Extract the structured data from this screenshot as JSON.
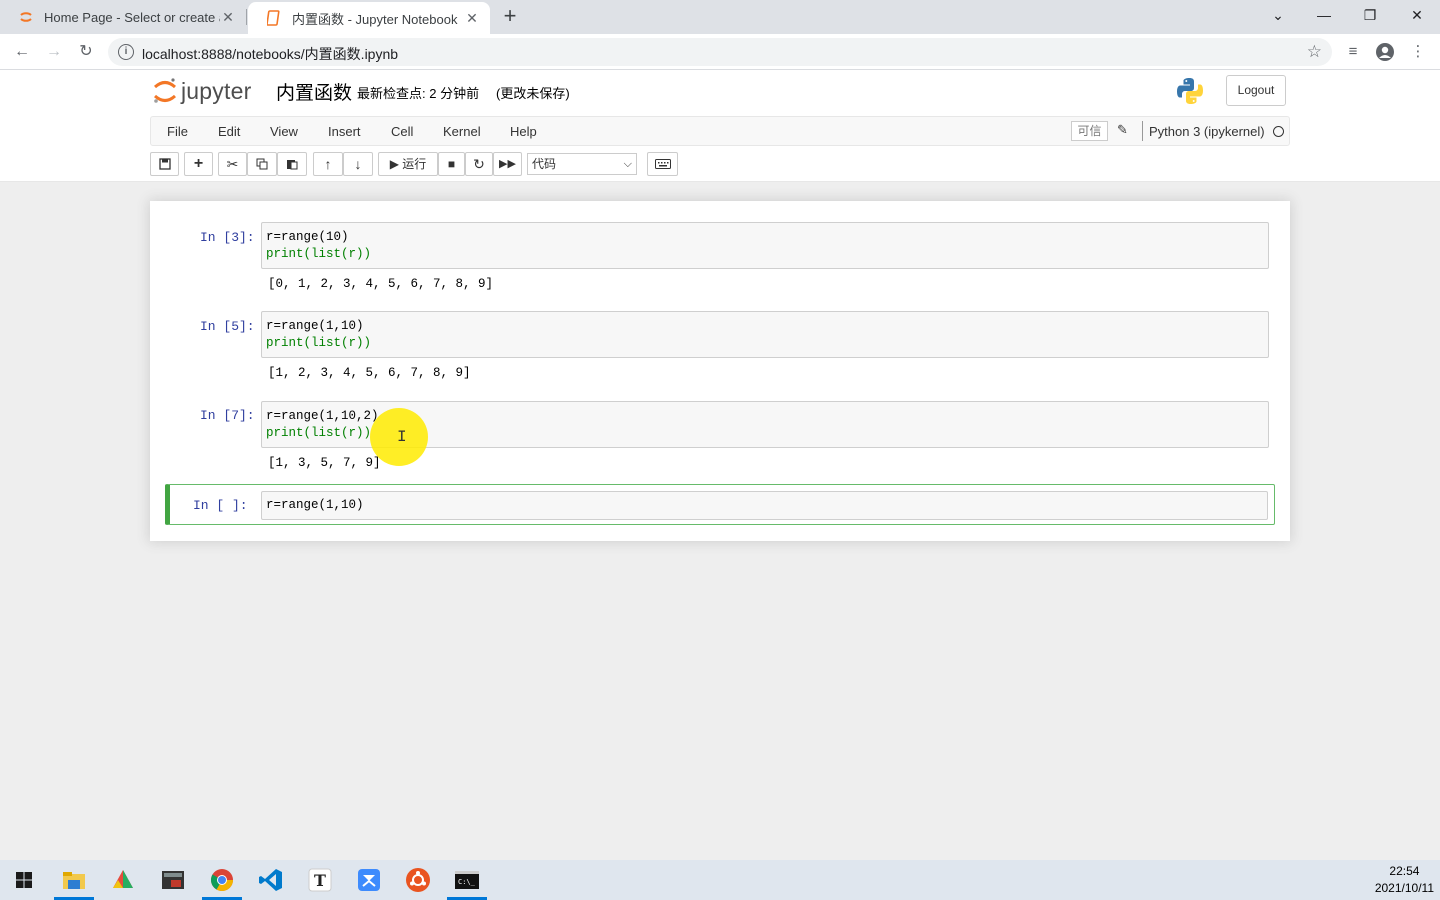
{
  "browser": {
    "tabs": [
      {
        "title": "Home Page - Select or create a",
        "active": false
      },
      {
        "title": "内置函数 - Jupyter Notebook",
        "active": true
      }
    ],
    "url": "localhost:8888/notebooks/内置函数.ipynb",
    "new_tab": "+",
    "close_glyph": "✕"
  },
  "header": {
    "logo_text": "jupyter",
    "notebook_name": "内置函数",
    "checkpoint": "最新检查点: 2 分钟前",
    "unsaved": "(更改未保存)",
    "logout": "Logout"
  },
  "menu": {
    "items": [
      "File",
      "Edit",
      "View",
      "Insert",
      "Cell",
      "Kernel",
      "Help"
    ],
    "trusted": "可信",
    "kernel": "Python 3 (ipykernel)"
  },
  "toolbar": {
    "run_label": "运行",
    "cell_type": "代码"
  },
  "cells": [
    {
      "prompt": "In  [3]:",
      "code": [
        "r=range(10)",
        "print(list(r))"
      ],
      "output": "[0, 1, 2, 3, 4, 5, 6, 7, 8, 9]"
    },
    {
      "prompt": "In  [5]:",
      "code": [
        "r=range(1,10)",
        "print(list(r))"
      ],
      "output": "[1, 2, 3, 4, 5, 6, 7, 8, 9]"
    },
    {
      "prompt": "In  [7]:",
      "code": [
        "r=range(1,10,2)",
        "print(list(r))"
      ],
      "output": "[1, 3, 5, 7, 9]"
    },
    {
      "prompt": "In  [ ]:",
      "code": [
        "r=range(1,10)"
      ],
      "output": ""
    }
  ],
  "taskbar": {
    "time": "22:54",
    "date": "2021/10/11"
  },
  "colors": {
    "prompt": "#303f9f",
    "selected_border": "#42a542"
  }
}
